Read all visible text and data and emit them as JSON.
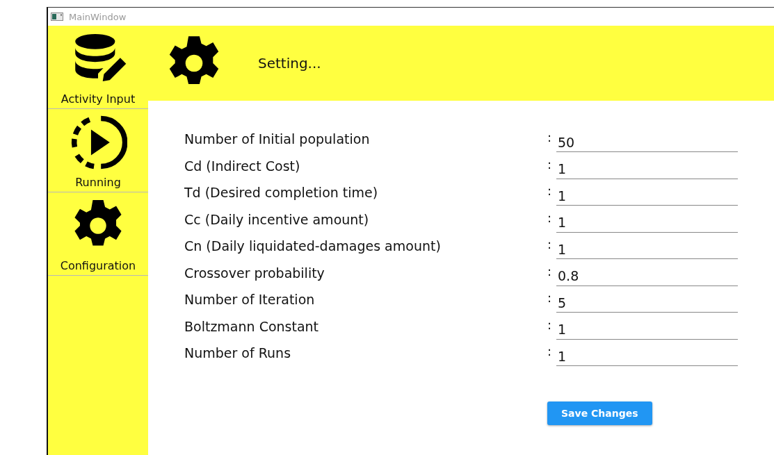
{
  "window": {
    "title": "MainWindow"
  },
  "sidebar": {
    "items": [
      {
        "label": "Activity Input"
      },
      {
        "label": "Running"
      },
      {
        "label": "Configuration"
      }
    ]
  },
  "header": {
    "title": "Setting..."
  },
  "settings": [
    {
      "label": "Number of Initial population",
      "separator": ":",
      "value": "50"
    },
    {
      "label": "Cd (Indirect Cost)",
      "separator": ":",
      "value": "1"
    },
    {
      "label": "Td (Desired completion time)",
      "separator": ":",
      "value": "1"
    },
    {
      "label": "Cc (Daily incentive amount)",
      "separator": ":",
      "value": "1"
    },
    {
      "label": "Cn (Daily liquidated-damages amount)",
      "separator": ":",
      "value": "1"
    },
    {
      "label": "Crossover probability",
      "separator": ":",
      "value": "0.8"
    },
    {
      "label": "Number of Iteration",
      "separator": ":",
      "value": "5"
    },
    {
      "label": "Boltzmann Constant",
      "separator": ":",
      "value": "1"
    },
    {
      "label": "Number of Runs",
      "separator": ":",
      "value": "1"
    }
  ],
  "buttons": [
    "Save Changes"
  ]
}
